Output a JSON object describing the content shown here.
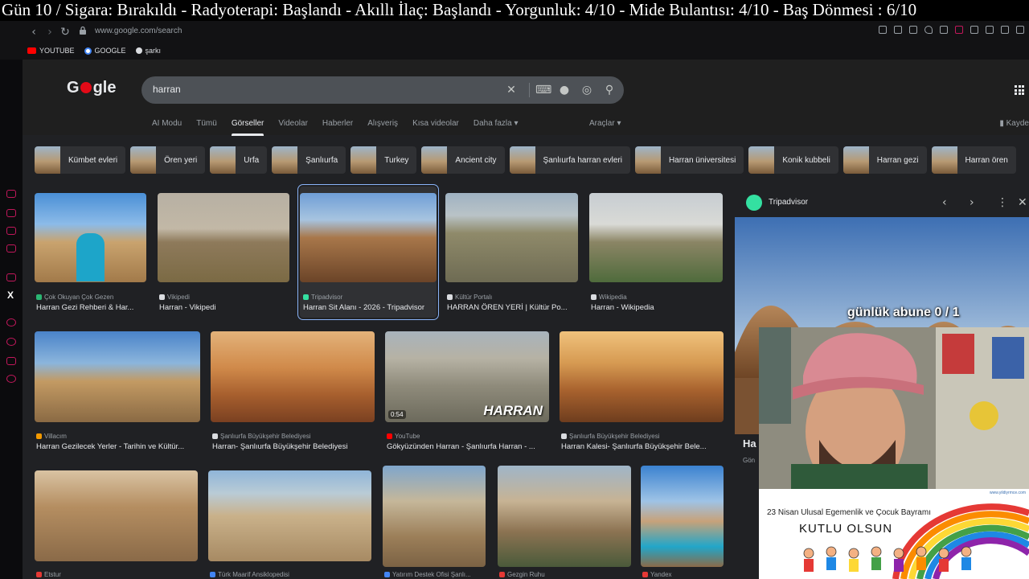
{
  "overlay_banner": "Gün 10 / Sigara: Bırakıldı - Radyoterapi: Başlandı - Akıllı İlaç: Başlandı - Yorgunluk:  4/10 -  Mide Bulantısı: 4/10 - Baş Dönmesi : 6/10",
  "browser": {
    "url": "www.google.com/search",
    "bookmarks": [
      {
        "label": "YOUTUBE",
        "color": "#ff0000"
      },
      {
        "label": "GOOGLE",
        "color": "#4285f4"
      },
      {
        "label": "şarkı",
        "color": "#dadce0"
      }
    ]
  },
  "google": {
    "logo": "Google",
    "query": "harran",
    "tabs": [
      "AI Modu",
      "Tümü",
      "Görseller",
      "Videolar",
      "Haberler",
      "Alışveriş",
      "Kısa videolar",
      "Daha fazla ▾"
    ],
    "active_tab": "Görseller",
    "tools": "Araçlar ▾",
    "save": "Kayde",
    "chips": [
      "Kümbet evleri",
      "Ören yeri",
      "Urfa",
      "Şanlıurfa",
      "Turkey",
      "Ancient city",
      "Şanlıurfa harran evleri",
      "Harran üniversitesi",
      "Konik kubbeli",
      "Harran gezi",
      "Harran ören"
    ]
  },
  "results": [
    {
      "source": "Çok Okuyan Çok Gezen",
      "title": "Harran Gezi Rehberi & Har...",
      "color": "#2bb673"
    },
    {
      "source": "Vikipedi",
      "title": "Harran - Vikipedi",
      "color": "#dadce0"
    },
    {
      "source": "Tripadvisor",
      "title": "Harran Sit Alanı - 2026 - Tripadvisor",
      "color": "#34e0a1"
    },
    {
      "source": "Kültür Portalı",
      "title": "HARRAN ÖREN YERİ | Kültür Po...",
      "color": "#dadce0"
    },
    {
      "source": "Wikipedia",
      "title": "Harran - Wikipedia",
      "color": "#dadce0"
    },
    {
      "source": "Villacım",
      "title": "Harran Gezilecek Yerler - Tarihin ve Kültür...",
      "color": "#f29900"
    },
    {
      "source": "Şanlıurfa Büyükşehir Belediyesi",
      "title": "Harran- Şanlıurfa Büyükşehir Belediyesi",
      "color": "#dadce0"
    },
    {
      "source": "YouTube",
      "title": "Gökyüzünden Harran - Şanlıurfa Harran - ...",
      "color": "#ff0000",
      "duration": "0:54",
      "overlay": "HARRAN"
    },
    {
      "source": "Şanlıurfa Büyükşehir Belediyesi",
      "title": "Harran Kalesi- Şanlıurfa Büyükşehir Bele...",
      "color": "#dadce0"
    },
    {
      "source": "Etstur",
      "title": "",
      "color": "#e53935"
    },
    {
      "source": "Türk Maarif Ansiklopedisi",
      "title": "",
      "color": "#4285f4"
    },
    {
      "source": "Yatırım Destek Ofisi Şanlı...",
      "title": "",
      "color": "#4285f4"
    },
    {
      "source": "Gezgin Ruhu",
      "title": "",
      "color": "#e53935"
    },
    {
      "source": "Yandex",
      "title": "",
      "color": "#e53935"
    }
  ],
  "panel": {
    "source": "Tripadvisor",
    "title": "Ha",
    "subtitle": "Gön"
  },
  "stream": {
    "subscriber_goal": "günlük abune 0 / 1",
    "banner_line1": "23 Nisan Ulusal Egemenlik ve Çocuk Bayramı",
    "banner_line2": "KUTLU OLSUN",
    "banner_url": "www.yildiyrmce.com"
  }
}
